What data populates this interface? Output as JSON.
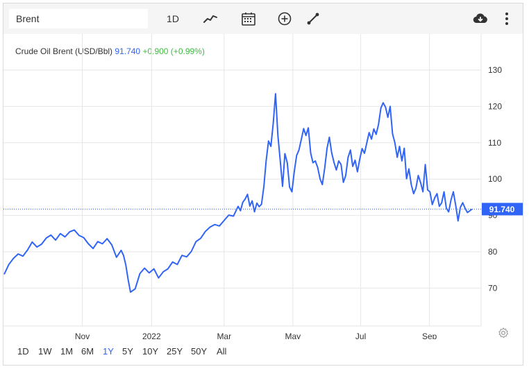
{
  "toolbar": {
    "search_value": "Brent",
    "interval_label": "1D",
    "icons": [
      "line-chart-icon",
      "calendar-icon",
      "add-circle-icon",
      "draw-line-icon",
      "download-cloud-icon",
      "more-vertical-icon"
    ]
  },
  "legend": {
    "name": "Crude Oil Brent (USD/Bbl)",
    "price": "91.740",
    "change": "+0.900 (+0.99%)"
  },
  "current_price_label": "91.740",
  "colors": {
    "line": "#2f64f6",
    "change_up": "#3fbb3f",
    "grid": "#e6e6e6"
  },
  "ranges": {
    "items": [
      "1D",
      "1W",
      "1M",
      "6M",
      "1Y",
      "5Y",
      "10Y",
      "25Y",
      "50Y",
      "All"
    ],
    "active": "1Y"
  },
  "chart_data": {
    "type": "line",
    "title": "Crude Oil Brent (USD/Bbl)",
    "y_ticks": [
      "70",
      "80",
      "90",
      "100",
      "110",
      "120",
      "130"
    ],
    "x_ticks": [
      {
        "label": "Nov",
        "t": 0.167
      },
      {
        "label": "2022",
        "t": 0.315
      },
      {
        "label": "Mar",
        "t": 0.47
      },
      {
        "label": "May",
        "t": 0.617
      },
      {
        "label": "Jul",
        "t": 0.762
      },
      {
        "label": "Sep",
        "t": 0.909
      }
    ],
    "ylim": [
      60,
      140
    ],
    "grid": true,
    "series": [
      {
        "name": "Brent",
        "points": [
          [
            0.0,
            73.8
          ],
          [
            0.01,
            76.5
          ],
          [
            0.02,
            78.2
          ],
          [
            0.03,
            79.4
          ],
          [
            0.04,
            78.8
          ],
          [
            0.05,
            80.5
          ],
          [
            0.06,
            82.7
          ],
          [
            0.07,
            81.3
          ],
          [
            0.08,
            82.1
          ],
          [
            0.09,
            83.8
          ],
          [
            0.1,
            84.6
          ],
          [
            0.11,
            83.2
          ],
          [
            0.12,
            85.0
          ],
          [
            0.13,
            84.1
          ],
          [
            0.14,
            85.5
          ],
          [
            0.15,
            86.0
          ],
          [
            0.16,
            84.5
          ],
          [
            0.17,
            83.9
          ],
          [
            0.18,
            82.2
          ],
          [
            0.19,
            80.9
          ],
          [
            0.2,
            82.8
          ],
          [
            0.21,
            82.2
          ],
          [
            0.22,
            83.6
          ],
          [
            0.23,
            81.9
          ],
          [
            0.24,
            78.5
          ],
          [
            0.25,
            80.4
          ],
          [
            0.255,
            79.0
          ],
          [
            0.26,
            76.4
          ],
          [
            0.265,
            72.3
          ],
          [
            0.27,
            68.9
          ],
          [
            0.28,
            69.8
          ],
          [
            0.29,
            74.0
          ],
          [
            0.3,
            75.5
          ],
          [
            0.31,
            74.2
          ],
          [
            0.32,
            75.3
          ],
          [
            0.33,
            72.8
          ],
          [
            0.34,
            74.5
          ],
          [
            0.35,
            75.3
          ],
          [
            0.36,
            77.2
          ],
          [
            0.37,
            76.5
          ],
          [
            0.38,
            79.0
          ],
          [
            0.39,
            78.6
          ],
          [
            0.4,
            80.1
          ],
          [
            0.41,
            82.8
          ],
          [
            0.42,
            83.7
          ],
          [
            0.43,
            85.6
          ],
          [
            0.44,
            86.8
          ],
          [
            0.45,
            87.5
          ],
          [
            0.46,
            87.1
          ],
          [
            0.47,
            88.6
          ],
          [
            0.48,
            90.1
          ],
          [
            0.49,
            89.8
          ],
          [
            0.5,
            92.5
          ],
          [
            0.505,
            91.3
          ],
          [
            0.51,
            93.6
          ],
          [
            0.515,
            94.5
          ],
          [
            0.52,
            95.8
          ],
          [
            0.525,
            92.6
          ],
          [
            0.53,
            94.0
          ],
          [
            0.535,
            91.0
          ],
          [
            0.54,
            93.4
          ],
          [
            0.545,
            92.4
          ],
          [
            0.55,
            93.1
          ],
          [
            0.555,
            98.0
          ],
          [
            0.56,
            105.1
          ],
          [
            0.565,
            110.5
          ],
          [
            0.57,
            109.0
          ],
          [
            0.575,
            115.2
          ],
          [
            0.58,
            123.5
          ],
          [
            0.585,
            112.0
          ],
          [
            0.59,
            105.0
          ],
          [
            0.595,
            98.0
          ],
          [
            0.6,
            107.0
          ],
          [
            0.605,
            104.5
          ],
          [
            0.61,
            97.8
          ],
          [
            0.615,
            96.5
          ],
          [
            0.62,
            102.1
          ],
          [
            0.625,
            106.5
          ],
          [
            0.63,
            108.0
          ],
          [
            0.635,
            110.9
          ],
          [
            0.64,
            113.9
          ],
          [
            0.645,
            112.0
          ],
          [
            0.65,
            114.1
          ],
          [
            0.655,
            107.2
          ],
          [
            0.66,
            104.5
          ],
          [
            0.665,
            105.0
          ],
          [
            0.67,
            103.2
          ],
          [
            0.675,
            100.1
          ],
          [
            0.68,
            98.5
          ],
          [
            0.685,
            103.0
          ],
          [
            0.69,
            108.5
          ],
          [
            0.695,
            111.5
          ],
          [
            0.7,
            107.2
          ],
          [
            0.705,
            104.5
          ],
          [
            0.71,
            102.5
          ],
          [
            0.715,
            105.0
          ],
          [
            0.72,
            104.0
          ],
          [
            0.725,
            99.1
          ],
          [
            0.73,
            101.0
          ],
          [
            0.735,
            106.0
          ],
          [
            0.74,
            108.0
          ],
          [
            0.745,
            103.5
          ],
          [
            0.75,
            105.2
          ],
          [
            0.755,
            102.0
          ],
          [
            0.76,
            105.5
          ],
          [
            0.765,
            108.4
          ],
          [
            0.77,
            107.1
          ],
          [
            0.775,
            110.0
          ],
          [
            0.78,
            112.8
          ],
          [
            0.785,
            111.0
          ],
          [
            0.79,
            113.8
          ],
          [
            0.795,
            112.3
          ],
          [
            0.8,
            115.0
          ],
          [
            0.805,
            119.5
          ],
          [
            0.81,
            121.0
          ],
          [
            0.815,
            119.8
          ],
          [
            0.82,
            117.0
          ],
          [
            0.825,
            120.0
          ],
          [
            0.83,
            112.5
          ],
          [
            0.835,
            110.0
          ],
          [
            0.84,
            106.0
          ],
          [
            0.845,
            109.0
          ],
          [
            0.85,
            105.0
          ],
          [
            0.855,
            108.5
          ],
          [
            0.86,
            100.1
          ],
          [
            0.865,
            102.8
          ],
          [
            0.87,
            98.5
          ],
          [
            0.875,
            96.0
          ],
          [
            0.88,
            97.5
          ],
          [
            0.885,
            101.0
          ],
          [
            0.89,
            99.0
          ],
          [
            0.895,
            96.5
          ],
          [
            0.9,
            104.0
          ],
          [
            0.905,
            97.0
          ],
          [
            0.91,
            96.5
          ],
          [
            0.915,
            93.0
          ],
          [
            0.92,
            94.8
          ],
          [
            0.925,
            96.0
          ],
          [
            0.93,
            92.5
          ],
          [
            0.935,
            93.5
          ],
          [
            0.94,
            96.5
          ],
          [
            0.945,
            92.0
          ],
          [
            0.95,
            91.0
          ],
          [
            0.955,
            94.3
          ],
          [
            0.96,
            96.5
          ],
          [
            0.965,
            92.8
          ],
          [
            0.97,
            88.5
          ],
          [
            0.975,
            92.2
          ],
          [
            0.98,
            93.5
          ],
          [
            0.985,
            92.0
          ],
          [
            0.99,
            90.8
          ],
          [
            1.0,
            91.74
          ]
        ]
      }
    ]
  }
}
